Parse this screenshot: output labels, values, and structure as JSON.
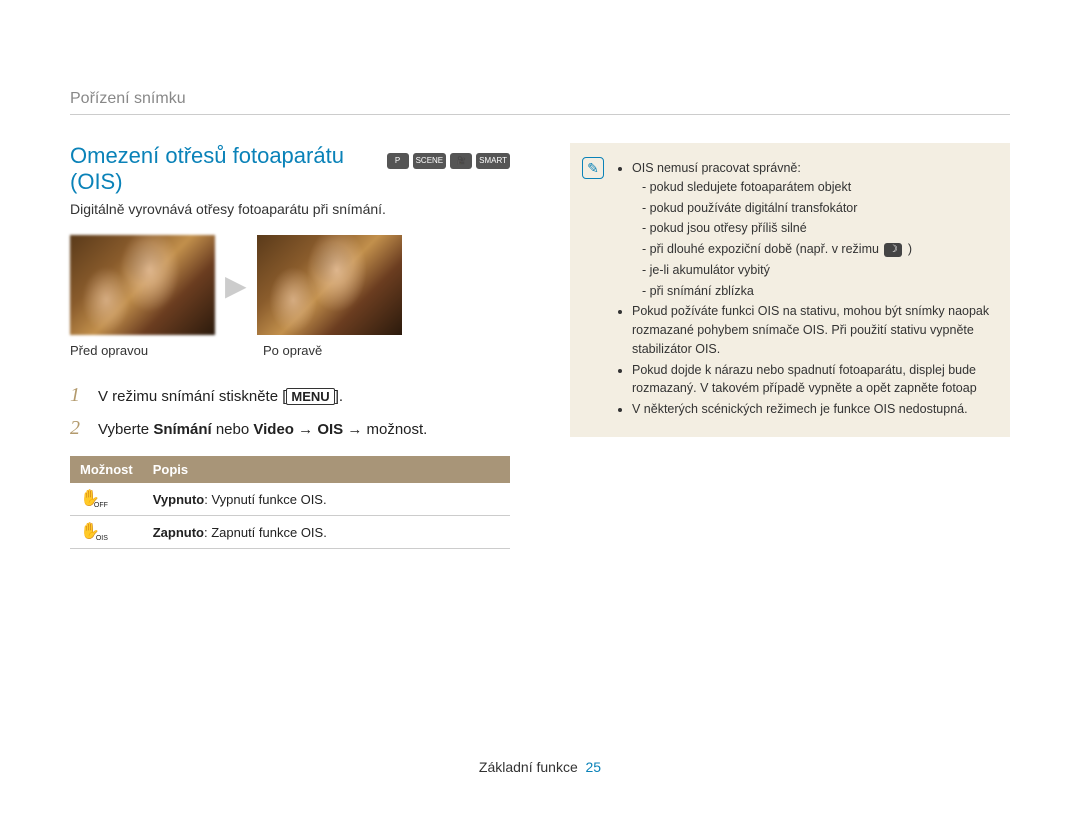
{
  "breadcrumb": "Pořízení snímku",
  "title": "Omezení otřesů fotoaparátu (OIS)",
  "mode_icons": [
    "P",
    "SCENE",
    "🎥",
    "SMART"
  ],
  "subtitle": "Digitálně vyrovnává otřesy fotoaparátu při snímání.",
  "caption_before": "Před opravou",
  "caption_after": "Po opravě",
  "steps": {
    "s1_num": "1",
    "s1_a": "V režimu snímání stiskněte [",
    "s1_menu": "MENU",
    "s1_b": "].",
    "s2_num": "2",
    "s2_a": "Vyberte ",
    "s2_bold1": "Snímání",
    "s2_mid": " nebo ",
    "s2_bold2": "Video",
    "s2_arrow1": " → ",
    "s2_bold3": "OIS",
    "s2_arrow2": " → možnost."
  },
  "table": {
    "h1": "Možnost",
    "h2": "Popis",
    "r1_sub": "OFF",
    "r1_bold": "Vypnuto",
    "r1_text": ": Vypnutí funkce OIS.",
    "r2_sub": "OIS",
    "r2_bold": "Zapnuto",
    "r2_text": ": Zapnutí funkce OIS."
  },
  "notes": {
    "n1": "OIS nemusí pracovat správně:",
    "n1a": "pokud sledujete fotoaparátem objekt",
    "n1b": "pokud používáte digitální transfokátor",
    "n1c": "pokud jsou otřesy příliš silné",
    "n1d_a": "při dlouhé expoziční době (např. v režimu ",
    "n1d_b": " )",
    "n1e": "je-li akumulátor vybitý",
    "n1f": "při snímání zblízka",
    "n2": "Pokud požíváte funkci OIS na stativu, mohou být snímky naopak rozmazané pohybem snímače OIS. Při použití stativu vypněte stabilizátor OIS.",
    "n3": "Pokud dojde k nárazu nebo spadnutí fotoaparátu, displej bude rozmazaný. V takovém případě vypněte a opět zapněte fotoap",
    "n4": "V některých scénických režimech je funkce OIS nedostupná."
  },
  "footer": {
    "section": "Základní funkce",
    "page": "25"
  }
}
